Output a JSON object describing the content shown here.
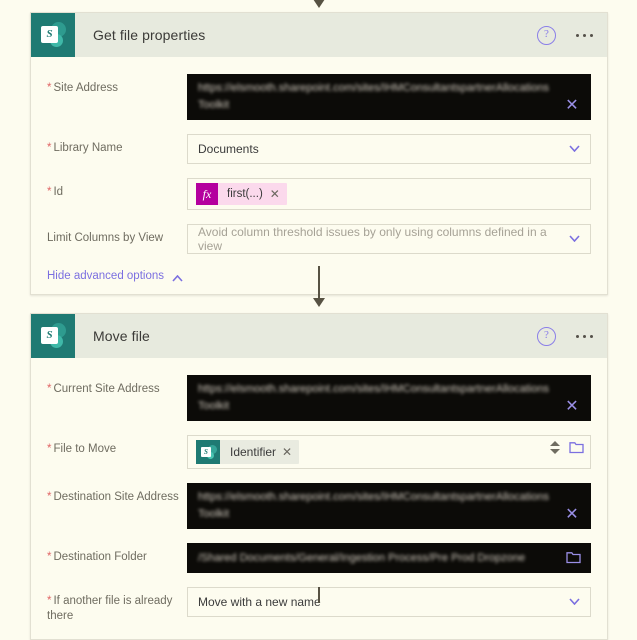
{
  "theme": {
    "page_bg": "#fdfcef",
    "card_bg": "#fdfcef",
    "card_header_bg": "#e7eade",
    "sharepoint_teal": "#1f7a73",
    "accent_purple": "#7b6fe0",
    "required_red": "#e06666",
    "fx_magenta": "#b4009e",
    "fx_chip_bg": "#fbd9ec",
    "redacted_black": "#0c0b08"
  },
  "cards": [
    {
      "id": "get-file-properties",
      "title": "Get file properties",
      "connector_icon": "sharepoint-icon",
      "help_icon": "help-circle-icon",
      "more_icon": "ellipsis-icon",
      "fields": [
        {
          "label": "Site Address",
          "required": true,
          "type": "redacted",
          "value": "https://elsmooth.sharepoint.com/sites/IHMConsultantspartnerAllocationsToolkit",
          "clear_icon": "close-icon"
        },
        {
          "label": "Library Name",
          "required": true,
          "type": "select",
          "value": "Documents",
          "chevron_icon": "chevron-down-icon"
        },
        {
          "label": "Id",
          "required": true,
          "type": "fx-token",
          "token_label": "first(...)",
          "token_badge": "fx",
          "remove_icon": "close-icon"
        },
        {
          "label": "Limit Columns by View",
          "required": false,
          "type": "select",
          "value": "",
          "placeholder": "Avoid column threshold issues by only using columns defined in a view",
          "chevron_icon": "chevron-down-icon"
        }
      ],
      "advanced_link": {
        "label": "Hide advanced options",
        "icon": "chevron-up-icon"
      }
    },
    {
      "id": "move-file",
      "title": "Move file",
      "connector_icon": "sharepoint-icon",
      "help_icon": "help-circle-icon",
      "more_icon": "ellipsis-icon",
      "fields": [
        {
          "label": "Current Site Address",
          "required": true,
          "type": "redacted",
          "value": "https://elsmooth.sharepoint.com/sites/IHMConsultantspartnerAllocationsToolkit",
          "clear_icon": "close-icon"
        },
        {
          "label": "File to Move",
          "required": true,
          "type": "sp-token",
          "token_label": "Identifier",
          "remove_icon": "close-icon",
          "spinner_icon": "spinner-updown-icon",
          "folder_icon": "folder-picker-icon"
        },
        {
          "label": "Destination Site Address",
          "required": true,
          "type": "redacted",
          "value": "https://elsmooth.sharepoint.com/sites/IHMConsultantspartnerAllocationsToolkit",
          "clear_icon": "close-icon"
        },
        {
          "label": "Destination Folder",
          "required": true,
          "type": "redacted-folder",
          "value": "/Shared Documents/General/Ingestion Process/Pre Prod Dropzone",
          "folder_icon": "folder-picker-icon"
        },
        {
          "label": "If another file is already there",
          "required": true,
          "type": "select",
          "value": "Move with a new name",
          "chevron_icon": "chevron-down-icon"
        }
      ]
    }
  ]
}
